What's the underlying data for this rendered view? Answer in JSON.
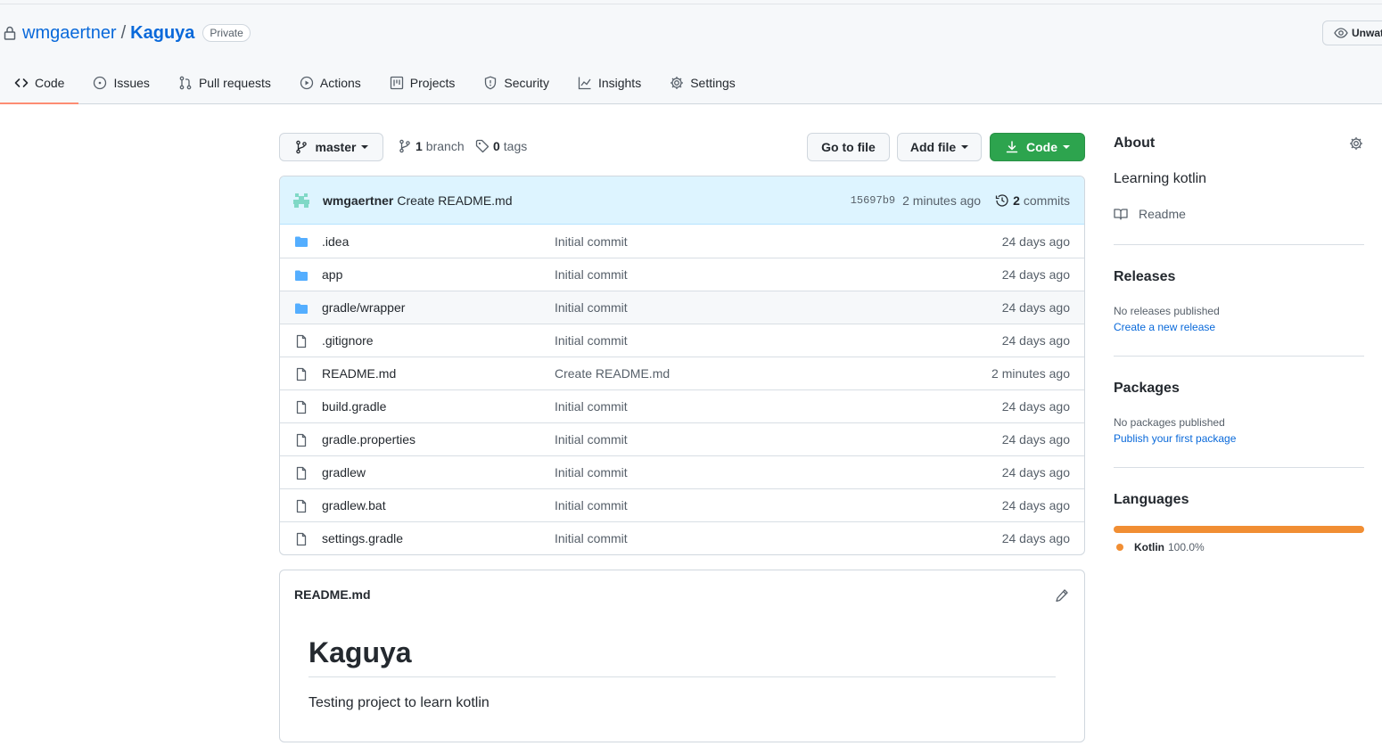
{
  "repo": {
    "owner": "wmgaertner",
    "separator": "/",
    "name": "Kaguya",
    "visibility": "Private",
    "unwatch_label": "Unwat"
  },
  "tabs": [
    {
      "label": "Code",
      "icon": "code-icon",
      "active": true
    },
    {
      "label": "Issues",
      "icon": "issue-icon"
    },
    {
      "label": "Pull requests",
      "icon": "pull-request-icon"
    },
    {
      "label": "Actions",
      "icon": "play-icon"
    },
    {
      "label": "Projects",
      "icon": "project-icon"
    },
    {
      "label": "Security",
      "icon": "shield-icon"
    },
    {
      "label": "Insights",
      "icon": "graph-icon"
    },
    {
      "label": "Settings",
      "icon": "gear-icon"
    }
  ],
  "toolbar": {
    "branch_label": "master",
    "branch_count": "1",
    "branch_word": "branch",
    "tag_count": "0",
    "tag_word": "tags",
    "go_to_file": "Go to file",
    "add_file": "Add file",
    "code": "Code"
  },
  "latest_commit": {
    "author": "wmgaertner",
    "message": "Create README.md",
    "sha": "15697b9",
    "time": "2 minutes ago",
    "count": "2",
    "count_word": "commits"
  },
  "files": [
    {
      "name": ".idea",
      "type": "dir",
      "message": "Initial commit",
      "age": "24 days ago"
    },
    {
      "name": "app",
      "type": "dir",
      "message": "Initial commit",
      "age": "24 days ago"
    },
    {
      "name": "gradle/wrapper",
      "type": "dir",
      "message": "Initial commit",
      "age": "24 days ago"
    },
    {
      "name": ".gitignore",
      "type": "file",
      "message": "Initial commit",
      "age": "24 days ago"
    },
    {
      "name": "README.md",
      "type": "file",
      "message": "Create README.md",
      "age": "2 minutes ago"
    },
    {
      "name": "build.gradle",
      "type": "file",
      "message": "Initial commit",
      "age": "24 days ago"
    },
    {
      "name": "gradle.properties",
      "type": "file",
      "message": "Initial commit",
      "age": "24 days ago"
    },
    {
      "name": "gradlew",
      "type": "file",
      "message": "Initial commit",
      "age": "24 days ago"
    },
    {
      "name": "gradlew.bat",
      "type": "file",
      "message": "Initial commit",
      "age": "24 days ago"
    },
    {
      "name": "settings.gradle",
      "type": "file",
      "message": "Initial commit",
      "age": "24 days ago"
    }
  ],
  "readme": {
    "filename": "README.md",
    "heading": "Kaguya",
    "body": "Testing project to learn kotlin"
  },
  "sidebar": {
    "about_title": "About",
    "description": "Learning kotlin",
    "readme_label": "Readme",
    "releases_title": "Releases",
    "releases_empty": "No releases published",
    "releases_link": "Create a new release",
    "packages_title": "Packages",
    "packages_empty": "No packages published",
    "packages_link": "Publish your first package",
    "languages_title": "Languages",
    "language_name": "Kotlin",
    "language_pct": "100.0%",
    "language_share": 1.0,
    "language_color": "#f18e33"
  },
  "colors": {
    "accent": "#0969da",
    "primary_button": "#2da44e",
    "active_tab_underline": "#fd8c73",
    "commit_bg": "#ddf4ff"
  }
}
